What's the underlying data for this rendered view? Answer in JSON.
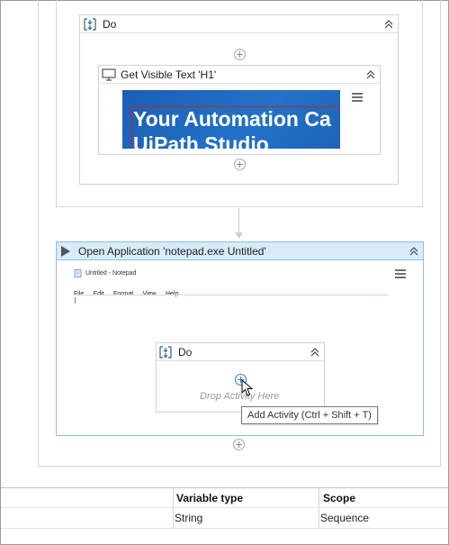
{
  "do_block_top": {
    "title": "Do"
  },
  "get_visible_text": {
    "title": "Get Visible Text 'H1'",
    "screenshot_line1": "Your Automation Ca",
    "screenshot_line2": "UiPath Studio"
  },
  "open_application": {
    "title": "Open Application 'notepad.exe Untitled'",
    "notepad_title": "Untitled - Notepad",
    "notepad_menu": [
      "File",
      "Edit",
      "Format",
      "View",
      "Help"
    ]
  },
  "do_block_inner": {
    "title": "Do",
    "drop_hint": "Drop Activity Here"
  },
  "tooltip": "Add Activity (Ctrl + Shift + T)",
  "variables_panel": {
    "columns": [
      "Variable type",
      "Scope"
    ],
    "rows": [
      {
        "type": "String",
        "scope": "Sequence"
      }
    ]
  },
  "colors": {
    "accent_header": "#d8ebf9",
    "selection_border": "#8cbfe3",
    "screenshot_blue": "#1a5fb4",
    "highlight_red": "#d02020"
  },
  "icons": [
    "do-sequence-icon",
    "collapse-chevron-icon",
    "monitor-icon",
    "play-icon",
    "menu-icon",
    "add-activity-icon",
    "cursor-icon",
    "notepad-icon"
  ]
}
